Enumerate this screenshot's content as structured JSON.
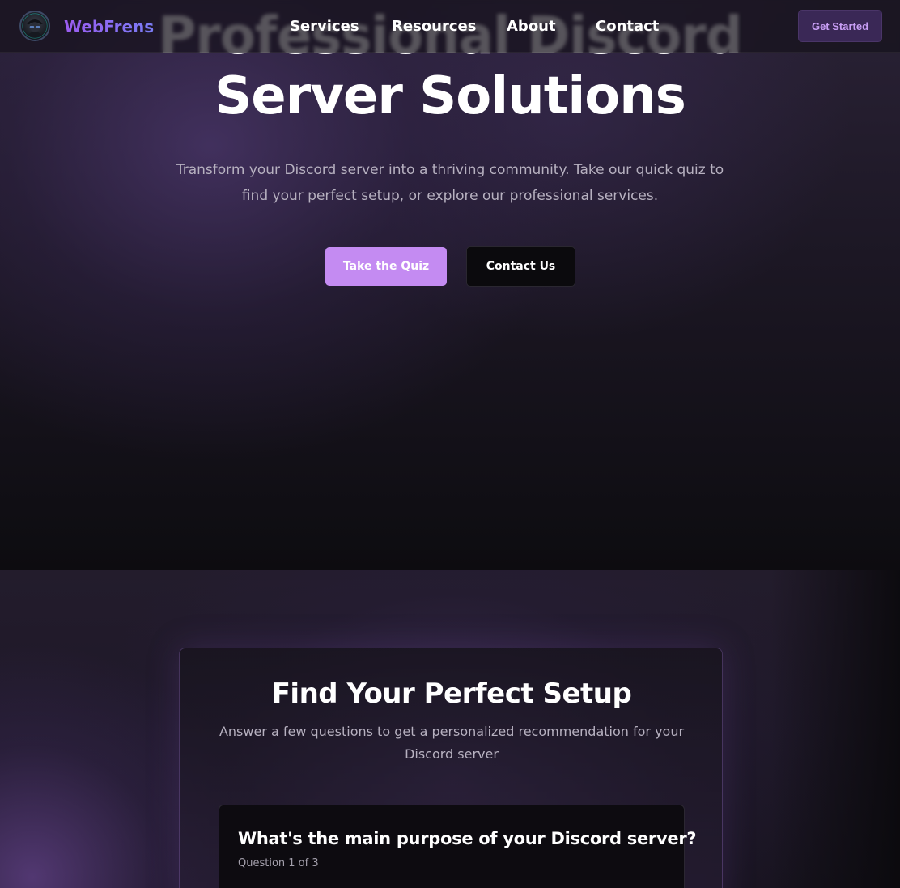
{
  "nav": {
    "brand": "WebFrens",
    "links": [
      "Services",
      "Resources",
      "About",
      "Contact"
    ],
    "cta_label": "Get Started",
    "avatar_icon": "hacker-avatar-icon"
  },
  "hero": {
    "title_line1": "Professional Discord",
    "title_line2": "Server Solutions",
    "subtitle": "Transform your Discord server into a thriving community. Take our quick quiz to find your perfect setup, or explore our professional services.",
    "primary_button": "Take the Quiz",
    "secondary_button": "Contact Us"
  },
  "quiz": {
    "title": "Find Your Perfect Setup",
    "subtitle": "Answer a few questions to get a personalized recommendation for your Discord server",
    "question": "What's the main purpose of your Discord server?",
    "progress": "Question 1 of 3"
  },
  "colors": {
    "accent": "#c48bf2",
    "brand_gradient_start": "#9b5cf0",
    "brand_gradient_end": "#7a7cf5",
    "background": "#0b0a0e"
  }
}
